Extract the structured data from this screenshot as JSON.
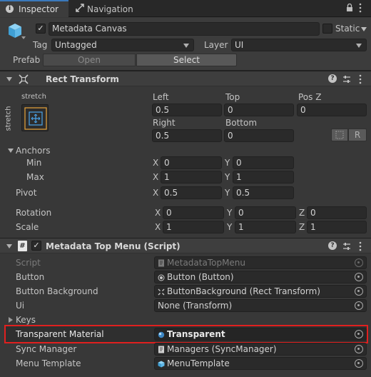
{
  "tabs": {
    "inspector": "Inspector",
    "navigation": "Navigation"
  },
  "object": {
    "name": "Metadata Canvas",
    "static_label": "Static",
    "tag_label": "Tag",
    "tag_value": "Untagged",
    "layer_label": "Layer",
    "layer_value": "UI",
    "prefab_label": "Prefab",
    "prefab_open": "Open",
    "prefab_select": "Select"
  },
  "rect_transform": {
    "title": "Rect Transform",
    "anchor_preset": "stretch",
    "left_label": "Left",
    "left": "0.5",
    "top_label": "Top",
    "top": "0",
    "posz_label": "Pos Z",
    "posz": "0",
    "right_label": "Right",
    "right": "0.5",
    "bottom_label": "Bottom",
    "bottom": "0",
    "r_button": "R",
    "anchors_label": "Anchors",
    "min_label": "Min",
    "min_x": "0",
    "min_y": "0",
    "max_label": "Max",
    "max_x": "1",
    "max_y": "1",
    "pivot_label": "Pivot",
    "pivot_x": "0.5",
    "pivot_y": "0.5",
    "rotation_label": "Rotation",
    "rot_x": "0",
    "rot_y": "0",
    "rot_z": "0",
    "scale_label": "Scale",
    "scale_x": "1",
    "scale_y": "1",
    "scale_z": "1",
    "axis_x": "X",
    "axis_y": "Y",
    "axis_z": "Z"
  },
  "script_component": {
    "title": "Metadata Top Menu (Script)",
    "fields": [
      {
        "label": "Script",
        "value": "MetadataTopMenu"
      },
      {
        "label": "Button",
        "value": "Button (Button)"
      },
      {
        "label": "Button Background",
        "value": "ButtonBackground (Rect Transform)"
      },
      {
        "label": "Ui",
        "value": "None (Transform)"
      },
      {
        "label": "Keys",
        "value": ""
      },
      {
        "label": "Transparent Material",
        "value": "Transparent"
      },
      {
        "label": "Sync Manager",
        "value": "Managers (SyncManager)"
      },
      {
        "label": "Menu Template",
        "value": "MenuTemplate"
      }
    ]
  },
  "colors": {
    "highlight_border": "#e0201f",
    "anchor_orange": "#e8a33a",
    "anchor_blue": "#4aa3e8",
    "cube_blue": "#5fb8e8"
  }
}
